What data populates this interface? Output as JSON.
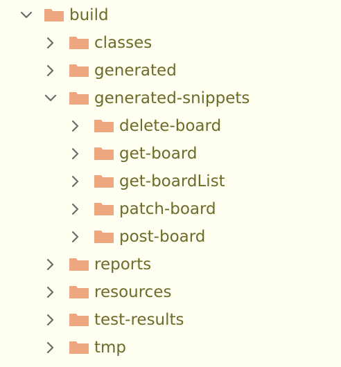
{
  "theme": {
    "background": "#fefef1",
    "text": "#6e6a27",
    "folder": "#eea77e",
    "chevron": "#6b6b6b"
  },
  "tree": {
    "root": {
      "label": "build",
      "icon": "folder-icon",
      "expanded": true
    },
    "items": [
      {
        "label": "classes",
        "expanded": false
      },
      {
        "label": "generated",
        "expanded": false
      },
      {
        "label": "generated-snippets",
        "expanded": true,
        "children": [
          {
            "label": "delete-board",
            "expanded": false
          },
          {
            "label": "get-board",
            "expanded": false
          },
          {
            "label": "get-boardList",
            "expanded": false
          },
          {
            "label": "patch-board",
            "expanded": false
          },
          {
            "label": "post-board",
            "expanded": false
          }
        ]
      },
      {
        "label": "reports",
        "expanded": false
      },
      {
        "label": "resources",
        "expanded": false
      },
      {
        "label": "test-results",
        "expanded": false
      },
      {
        "label": "tmp",
        "expanded": false
      }
    ]
  }
}
